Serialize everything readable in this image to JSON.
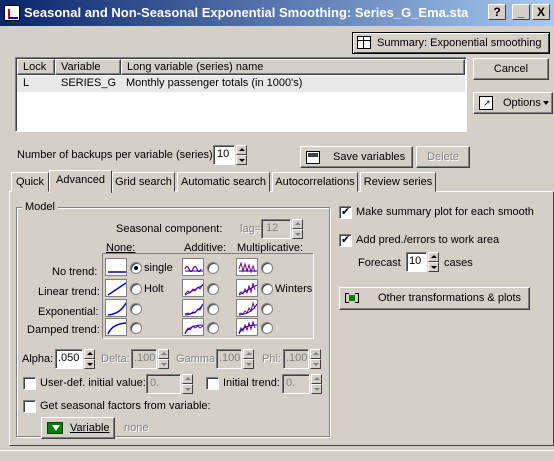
{
  "window": {
    "title": "Seasonal and Non-Seasonal Exponential Smoothing: Series_G_Ema.sta",
    "help_label": "?",
    "minimize_label": "_",
    "close_label": "X"
  },
  "summary_button": {
    "label": "Summary: Exponential smoothing"
  },
  "cancel_button": {
    "label": "Cancel"
  },
  "options_button": {
    "label": "Options"
  },
  "variable_table": {
    "headers": [
      "Lock",
      "Variable",
      "Long variable (series) name"
    ],
    "rows": [
      {
        "lock": "L",
        "variable": "SERIES_G",
        "long_name": "Monthly passenger totals (in 1000's)"
      }
    ]
  },
  "backups": {
    "label": "Number of backups per variable (series):",
    "value": "10"
  },
  "save_variables_button": {
    "label": "Save variables"
  },
  "delete_button": {
    "label": "Delete"
  },
  "tabs": [
    {
      "label": "Quick",
      "active": false
    },
    {
      "label": "Advanced",
      "active": true
    },
    {
      "label": "Grid search",
      "active": false
    },
    {
      "label": "Automatic search",
      "active": false
    },
    {
      "label": "Autocorrelations",
      "active": false
    },
    {
      "label": "Review series",
      "active": false
    }
  ],
  "model": {
    "title": "Model",
    "seasonal_component_label": "Seasonal component:",
    "lag_label": "lag=",
    "lag_value": "12",
    "col_none": "None:",
    "col_additive": "Additive:",
    "col_multiplicative": "Multiplicative:",
    "rows": [
      {
        "label": "No trend:",
        "none_text": "single",
        "mult_text": ""
      },
      {
        "label": "Linear trend:",
        "none_text": "Holt",
        "mult_text": "Winters"
      },
      {
        "label": "Exponential:",
        "none_text": "",
        "mult_text": ""
      },
      {
        "label": "Damped trend:",
        "none_text": "",
        "mult_text": ""
      }
    ],
    "alpha_label": "Alpha:",
    "alpha_value": ".050",
    "delta_label": "Delta:",
    "delta_value": ".100",
    "gamma_label": "Gamma:",
    "gamma_value": ".100",
    "phi_label": "Phi:",
    "phi_value": ".100",
    "user_initial_label": "User-def. initial value:",
    "user_initial_value": "0.",
    "initial_trend_label": "Initial trend:",
    "initial_trend_value": "0.",
    "seasonal_factors_label": "Get seasonal factors from variable:",
    "variable_button_label": "Variable",
    "variable_value": "none"
  },
  "right_panel": {
    "summary_plot_label": "Make summary plot for each smooth",
    "summary_plot_checked": true,
    "add_pred_label": "Add pred./errors to work area",
    "add_pred_checked": true,
    "forecast_label": "Forecast",
    "forecast_value": "10",
    "cases_label": "cases",
    "other_transformations_label": "Other transformations & plots"
  },
  "colors": {
    "title_start": "#0a246a",
    "title_end": "#a6caf0",
    "face": "#d4d0c8",
    "plot_purple": "#800080",
    "plot_blue": "#0000c0"
  }
}
